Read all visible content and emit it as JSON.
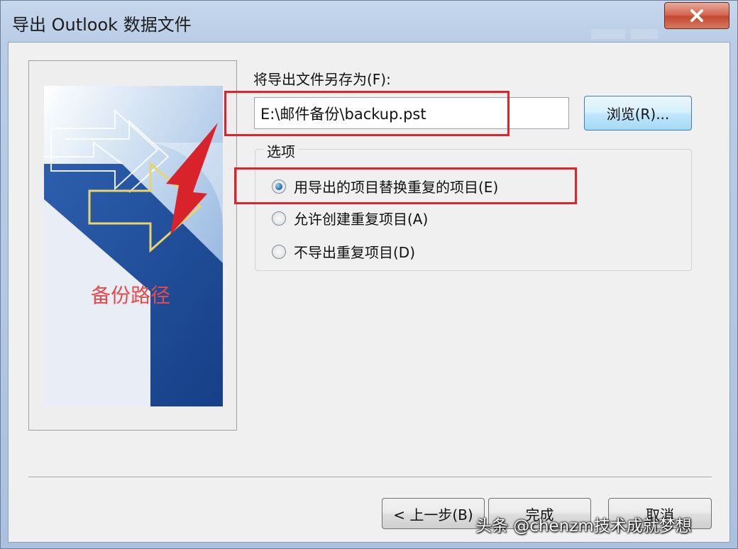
{
  "window": {
    "title": "导出 Outlook 数据文件",
    "close_icon": "close-icon"
  },
  "wizard_image": {
    "caption": "备份路径"
  },
  "form": {
    "save_as_label": "将导出文件另存为(F):",
    "path_value": "E:\\邮件备份\\backup.pst",
    "browse_label": "浏览(R)..."
  },
  "options": {
    "legend": "选项",
    "items": [
      {
        "label": "用导出的项目替换重复的项目(E)",
        "checked": true
      },
      {
        "label": "允许创建重复项目(A)",
        "checked": false
      },
      {
        "label": "不导出重复项目(D)",
        "checked": false
      }
    ]
  },
  "buttons": {
    "back": "< 上一步(B)",
    "finish": "完成",
    "cancel": "取消"
  },
  "watermark": "头条 @chenzm技术成就梦想",
  "colors": {
    "highlight_red": "#e0222a",
    "accent_blue": "#2b72b8"
  }
}
